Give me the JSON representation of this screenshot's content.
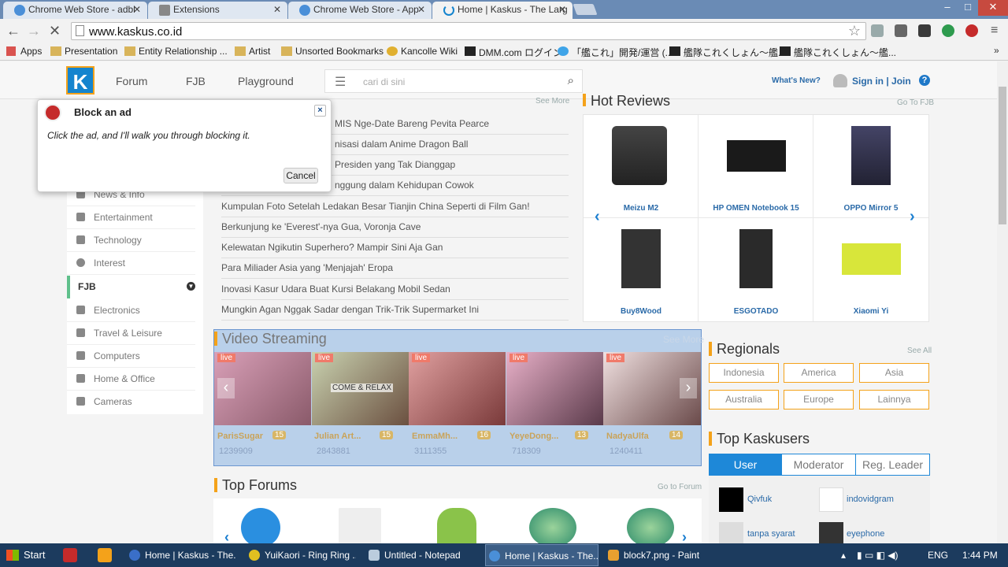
{
  "browser": {
    "tabs": [
      {
        "title": "Chrome Web Store - adbl",
        "active": false
      },
      {
        "title": "Extensions",
        "active": false
      },
      {
        "title": "Chrome Web Store - App",
        "active": false
      },
      {
        "title": "Home | Kaskus - The Larg",
        "active": true
      }
    ],
    "url": "www.kaskus.co.id",
    "bookmarks": [
      "Apps",
      "Presentation",
      "Entity Relationship ...",
      "Artist",
      "Unsorted Bookmarks",
      "Kancolle Wiki",
      "DMM.com ログイン",
      "「艦これ」開発/運営 (...",
      "艦隊これくしょん〜艦...",
      "艦隊これくしょん〜艦..."
    ]
  },
  "header": {
    "logo": "K",
    "nav": [
      "Forum",
      "FJB",
      "Playground"
    ],
    "search_placeholder": "cari di sini",
    "whats_new": "What's New?",
    "signin": "Sign in | Join",
    "help": "?"
  },
  "sidebar": {
    "items_top": [
      "News & Info",
      "Entertainment",
      "Technology",
      "Interest"
    ],
    "fjb_label": "FJB",
    "items_fjb": [
      "Electronics",
      "Travel & Leisure",
      "Computers",
      "Home & Office",
      "Cameras"
    ]
  },
  "news": {
    "see_more": "See More",
    "items": [
      "MIS Nge-Date Bareng Pevita Pearce",
      "nisasi dalam Anime Dragon Ball",
      "Presiden yang Tak Dianggap",
      "nggung dalam Kehidupan Cowok",
      "Kumpulan Foto Setelah Ledakan Besar Tianjin China Seperti di Film Gan!",
      "Berkunjung ke 'Everest'-nya Gua, Voronja Cave",
      "Kelewatan Ngikutin Superhero? Mampir Sini Aja Gan",
      "Para Miliader Asia yang 'Menjajah' Eropa",
      "Inovasi Kasur Udara Buat Kursi Belakang Mobil Sedan",
      "Mungkin Agan Nggak Sadar dengan Trik-Trik Supermarket Ini"
    ]
  },
  "hot_reviews": {
    "title": "Hot Reviews",
    "link": "Go To FJB",
    "products": [
      "Meizu M2",
      "HP OMEN Notebook 15",
      "OPPO Mirror 5",
      "Buy8Wood",
      "ESGOTADO",
      "Xiaomi Yi"
    ]
  },
  "video": {
    "title": "Video Streaming",
    "see_more": "See More",
    "live_label": "live",
    "overlay_text": "COME & RELAX",
    "streams": [
      {
        "name": "ParisSugar",
        "badge": "15",
        "views": "1239909"
      },
      {
        "name": "Julian Art...",
        "badge": "15",
        "views": "2843881"
      },
      {
        "name": "EmmaMh...",
        "badge": "16",
        "views": "3111355"
      },
      {
        "name": "YeyeDong...",
        "badge": "13",
        "views": "718309"
      },
      {
        "name": "NadyaUlfa",
        "badge": "14",
        "views": "1240411"
      }
    ]
  },
  "regionals": {
    "title": "Regionals",
    "link": "See All",
    "items": [
      "Indonesia",
      "America",
      "Asia",
      "Australia",
      "Europe",
      "Lainnya"
    ]
  },
  "top_kaskusers": {
    "title": "Top Kaskusers",
    "tabs": [
      "User",
      "Moderator",
      "Reg. Leader"
    ],
    "users": [
      "Qivfuk",
      "indovidgram",
      "tanpa syarat",
      "eyephone"
    ]
  },
  "top_forums": {
    "title": "Top Forums",
    "link": "Go to Forum"
  },
  "popup": {
    "title": "Block an ad",
    "message": "Click the ad, and I'll walk you through blocking it.",
    "cancel": "Cancel",
    "close": "×"
  },
  "taskbar": {
    "start": "Start",
    "items": [
      "Home | Kaskus - The...",
      "YuiKaori - Ring Ring ...",
      "Untitled - Notepad",
      "Home | Kaskus - The...",
      "block7.png - Paint"
    ],
    "lang": "ENG",
    "time": "1:44 PM"
  }
}
